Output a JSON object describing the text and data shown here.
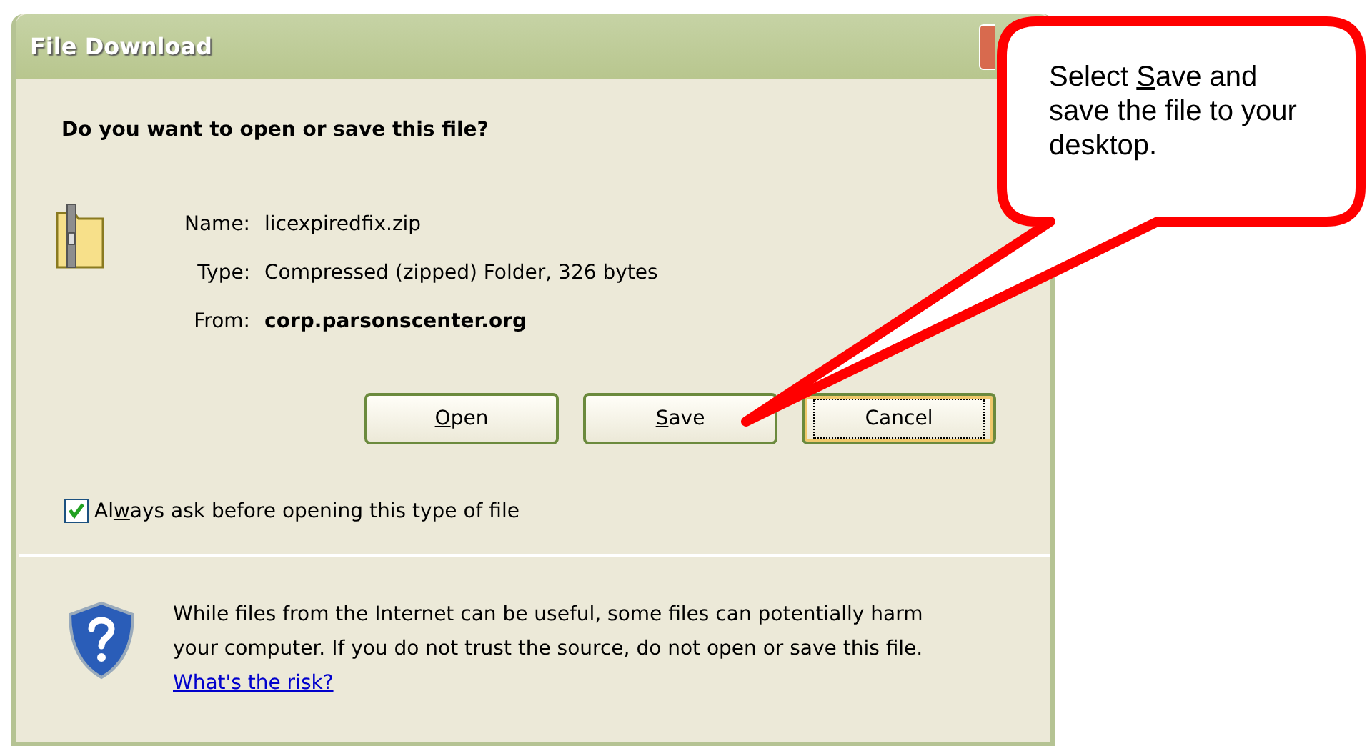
{
  "window": {
    "title": "File Download",
    "close_visible": true
  },
  "question": "Do you want to open or save this file?",
  "details": [
    {
      "label": "Name:",
      "value": "licexpiredfix.zip",
      "bold": false
    },
    {
      "label": "Type:",
      "value": "Compressed (zipped) Folder, 326 bytes",
      "bold": false
    },
    {
      "label": "From:",
      "value": "corp.parsonscenter.org",
      "bold": true
    }
  ],
  "buttons": [
    {
      "key": "O",
      "post": "pen",
      "focused": false
    },
    {
      "key": "S",
      "post": "ave",
      "focused": false
    },
    {
      "pre": "Cancel",
      "focused": true
    }
  ],
  "checkbox": {
    "pre": "Al",
    "key": "w",
    "post": "ays ask before opening this type of file",
    "checked": true
  },
  "warning": {
    "text": "While files from the Internet can be useful, some files can potentially harm your computer. If you do not trust the source, do not open or save this file.",
    "link": "What's the risk?"
  },
  "callout": {
    "pre": "Select ",
    "key": "S",
    "post": "ave and save the file to your desktop."
  }
}
